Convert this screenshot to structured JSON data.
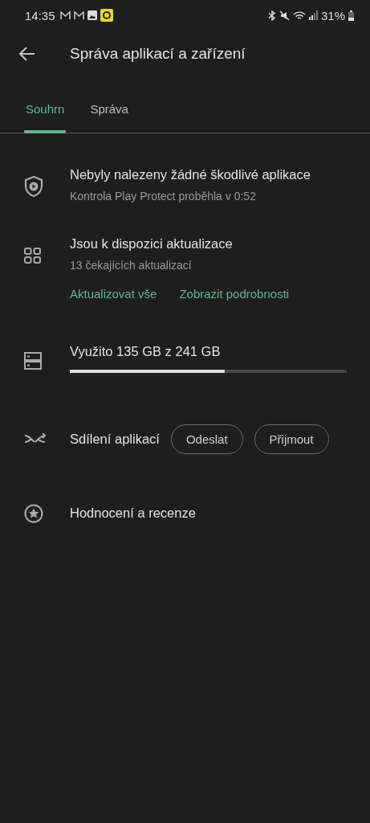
{
  "status_bar": {
    "time": "14:35",
    "battery": "31%"
  },
  "header": {
    "title": "Správa aplikací a zařízení"
  },
  "tabs": [
    {
      "label": "Souhrn",
      "selected": true
    },
    {
      "label": "Správa",
      "selected": false
    }
  ],
  "sections": [
    {
      "kind": "protect",
      "title": "Nebyly nalezeny žádné škodlivé aplikace",
      "subtitle": "Kontrola Play Protect proběhla v 0:52"
    },
    {
      "kind": "updates",
      "title": "Jsou k dispozici aktualizace",
      "subtitle": "13 čekajících aktualizací",
      "links": [
        "Aktualizovat vše",
        "Zobrazit podrobnosti"
      ]
    },
    {
      "kind": "storage",
      "title": "Využito 135 GB z 241 GB",
      "level": 0.56
    },
    {
      "kind": "sharing",
      "title": "Sdílení aplikací",
      "buttons": [
        "Odeslat",
        "Přijmout"
      ]
    },
    {
      "kind": "ratings",
      "title": "Hodnocení a recenze"
    }
  ]
}
